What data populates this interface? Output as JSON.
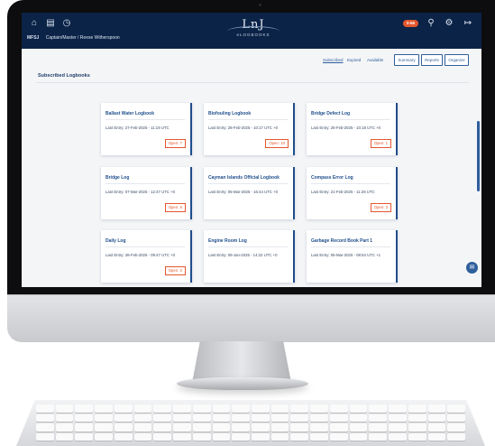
{
  "topbar": {
    "icons": [
      "home-icon",
      "list-icon",
      "history-icon"
    ],
    "right_icons": [
      "search-icon",
      "settings-icon",
      "logout-icon"
    ],
    "badge": "0-66",
    "breadcrumb": {
      "vessel": "MFSJ",
      "path": "Captain/Master / Reese Witherspoon"
    },
    "logo": {
      "mark": "LnJ",
      "text": "eLOGBOOKS"
    }
  },
  "toolbar": {
    "filters": [
      "Subscribed",
      "Expired",
      "Available"
    ],
    "buttons": [
      "Summary",
      "Reports",
      "Organize"
    ]
  },
  "section_title": "Subscribed Logbooks",
  "cards": [
    {
      "title": "Ballast Water Logbook",
      "entry": "Last Entry: 27-Feb-2025 - 11:19 UTC",
      "open": "Open: 7"
    },
    {
      "title": "Biofouling Logbook",
      "entry": "Last Entry: 28-Feb-2025 - 10:17 UTC +0",
      "open": "Open: 10"
    },
    {
      "title": "Bridge Defect Log",
      "entry": "Last Entry: 26-Feb-2025 - 10:18 UTC +0",
      "open": "Open: 1"
    },
    {
      "title": "Bridge Log",
      "entry": "Last Entry: 07-Mar-2025 - 12:47 UTC +0",
      "open": "Open: 5"
    },
    {
      "title": "Cayman Islands Official Logbook",
      "entry": "Last Entry: 05-Mar-2025 - 16:44 UTC +0",
      "open": ""
    },
    {
      "title": "Compass Error Log",
      "entry": "Last Entry: 21-Feb-2025 - 11:28 UTC",
      "open": "Open: 3"
    },
    {
      "title": "Daily Log",
      "entry": "Last Entry: 28-Feb-2025 - 09:47 UTC +0",
      "open": "Open: 2"
    },
    {
      "title": "Engine Room Log",
      "entry": "Last Entry: 09-Jan-2025 - 14:22 UTC +0",
      "open": ""
    },
    {
      "title": "Garbage Record Book Part 1",
      "entry": "Last Entry: 06-Mar-2025 - 08:54 UTC +1",
      "open": ""
    }
  ]
}
